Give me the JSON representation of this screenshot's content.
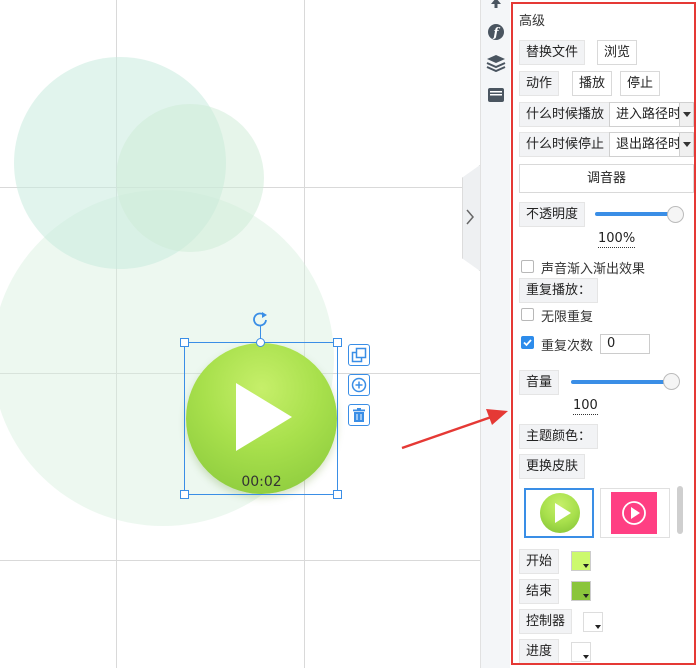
{
  "canvas": {
    "time_label": "00:02"
  },
  "colors": {
    "accent": "#3a8ee6",
    "panel_border": "#e53935",
    "play_green": "#a8e04c",
    "skin_pink": "#ff3f83",
    "start_color": "#ccf96d",
    "end_color": "#8ac53c"
  },
  "icons": {
    "rotate": "rotate-icon",
    "duplicate": "duplicate-icon",
    "add": "add-circle-icon",
    "delete": "trash-icon",
    "play": "play-icon"
  },
  "panel": {
    "title": "高级",
    "replace_file": "替换文件",
    "browse": "浏览",
    "action": "动作",
    "play": "播放",
    "stop": "停止",
    "when_play_label": "什么时候播放",
    "when_play_value": "进入路径时",
    "when_stop_label": "什么时候停止",
    "when_stop_value": "退出路径时",
    "mixer": "调音器",
    "opacity_label": "不透明度",
    "opacity_value": "100%",
    "fade_label": "声音渐入渐出效果",
    "repeat_label": "重复播放：",
    "infinite_label": "无限重复",
    "repeat_count_label": "重复次数",
    "repeat_count_value": "0",
    "volume_label": "音量",
    "volume_value": "100",
    "theme_color_label": "主题颜色：",
    "change_skin": "更换皮肤",
    "start_label": "开始",
    "end_label": "结束",
    "controller_label": "控制器",
    "progress_label": "进度"
  }
}
